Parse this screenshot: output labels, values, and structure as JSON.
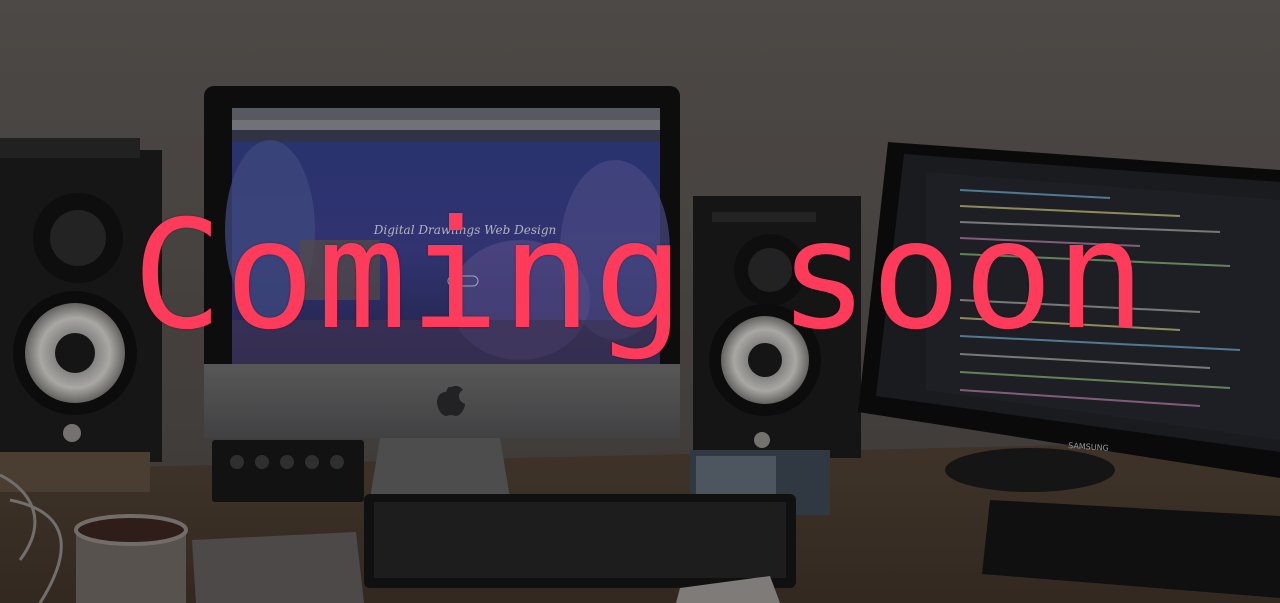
{
  "overlay": {
    "headline": "Coming soon",
    "color": "#ff3b5c"
  },
  "scene": {
    "description_tags": [
      "desk",
      "imac",
      "studio-monitor-speakers",
      "external-monitor",
      "keyboards",
      "mug",
      "audio-mixer"
    ],
    "imac_screen": {
      "headline": "Digital Drawlings Web Design"
    },
    "monitor_brand": "SAMSUNG",
    "colors": {
      "wall": "#5b5653",
      "desk": "#4a3b2e",
      "dim_overlay": "rgba(0,0,0,0.35)"
    }
  }
}
